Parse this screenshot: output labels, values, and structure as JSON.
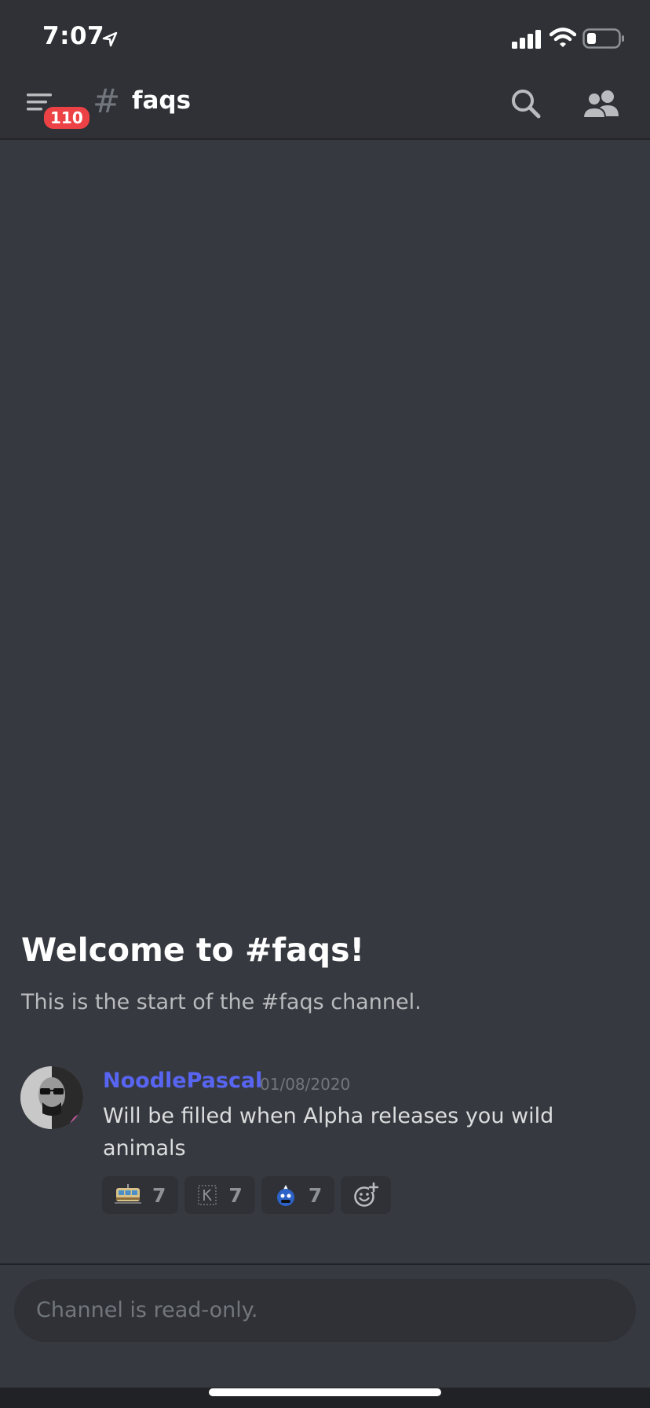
{
  "status_bar": {
    "time": "7:07",
    "icons": [
      "location-arrow-icon",
      "signal-icon",
      "wifi-icon",
      "battery-icon"
    ]
  },
  "header": {
    "menu_badge": "110",
    "hash": "#",
    "channel_name": "faqs",
    "icons": [
      "hamburger-icon",
      "search-icon",
      "members-icon"
    ]
  },
  "welcome": {
    "title": "Welcome to #faqs!",
    "subtitle": "This is the start of the #faqs channel."
  },
  "message": {
    "author": "NoodlePascal",
    "timestamp": "01/08/2020",
    "text": "Will be filled when Alpha releases you wild animals",
    "reactions": [
      {
        "emoji": "tram-icon",
        "count": "7"
      },
      {
        "emoji": "k-emoji-icon",
        "count": "7"
      },
      {
        "emoji": "blob-emoji-icon",
        "count": "7"
      }
    ],
    "add_reaction_icon": "add-reaction-icon"
  },
  "composer": {
    "placeholder": "Channel is read-only."
  },
  "colors": {
    "background": "#36393f",
    "header": "#2f3136",
    "author": "#5865f2",
    "badge": "#ed4245"
  }
}
